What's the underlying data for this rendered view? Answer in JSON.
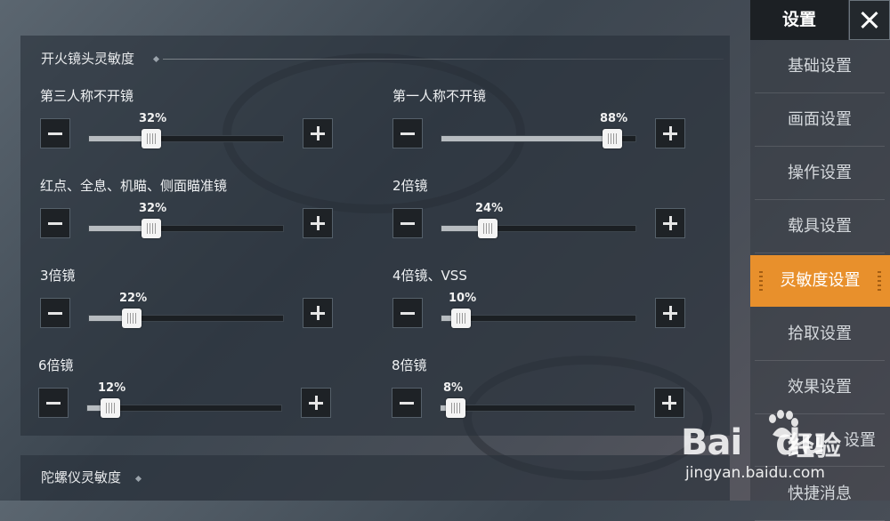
{
  "panel": {
    "section_title": "开火镜头灵敏度",
    "next_section_title": "陀螺仪灵敏度"
  },
  "sliders": [
    {
      "label": "第三人称不开镜",
      "value_text": "32%",
      "value": 32
    },
    {
      "label": "第一人称不开镜",
      "value_text": "88%",
      "value": 88
    },
    {
      "label": "红点、全息、机瞄、侧面瞄准镜",
      "value_text": "32%",
      "value": 32
    },
    {
      "label": "2倍镜",
      "value_text": "24%",
      "value": 24
    },
    {
      "label": "3倍镜",
      "value_text": "22%",
      "value": 22
    },
    {
      "label": "4倍镜、VSS",
      "value_text": "10%",
      "value": 10
    },
    {
      "label": "6倍镜",
      "value_text": "12%",
      "value": 12
    },
    {
      "label": "8倍镜",
      "value_text": "8%",
      "value": 8
    }
  ],
  "sidebar": {
    "title": "设置",
    "items": [
      {
        "label": "基础设置"
      },
      {
        "label": "画面设置"
      },
      {
        "label": "操作设置"
      },
      {
        "label": "载具设置"
      },
      {
        "label": "灵敏度设置",
        "active": true
      },
      {
        "label": "拾取设置"
      },
      {
        "label": "效果设置"
      },
      {
        "label": "设置"
      },
      {
        "label": "快捷消息"
      }
    ]
  },
  "watermark": {
    "logo": "Bai",
    "logo2": "du",
    "text": "经验",
    "url": "jingyan.baidu.com"
  },
  "colors": {
    "accent": "#e8902c",
    "panel_bg": "#28303a",
    "button_bg": "#1e2226"
  }
}
